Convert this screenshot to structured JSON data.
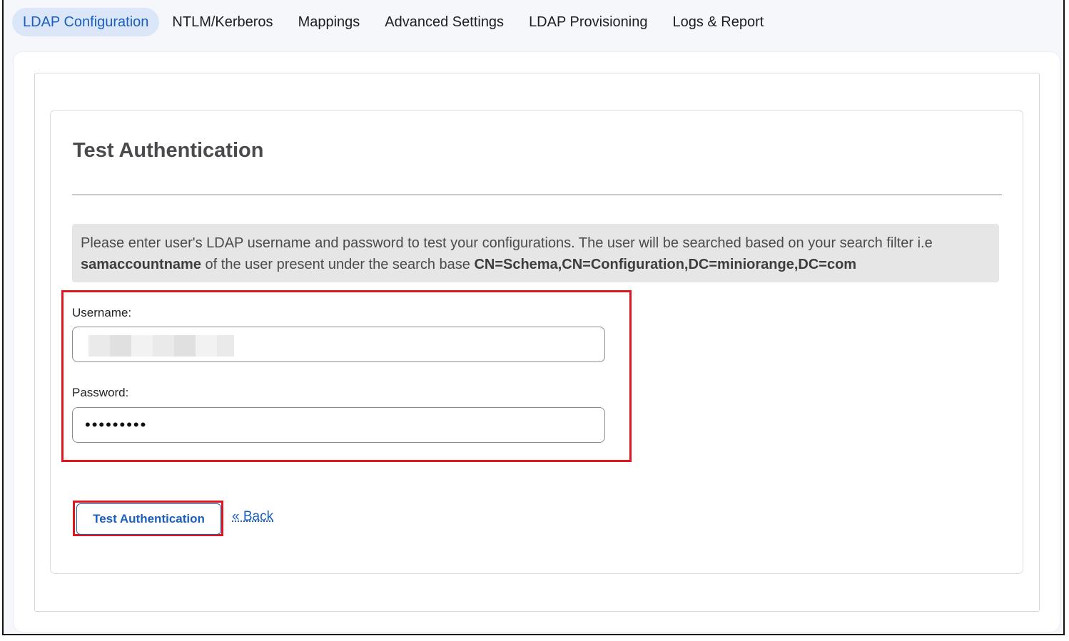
{
  "tabs": [
    {
      "label": "LDAP Configuration",
      "active": true
    },
    {
      "label": "NTLM/Kerberos",
      "active": false
    },
    {
      "label": "Mappings",
      "active": false
    },
    {
      "label": "Advanced Settings",
      "active": false
    },
    {
      "label": "LDAP Provisioning",
      "active": false
    },
    {
      "label": "Logs & Report",
      "active": false
    }
  ],
  "card": {
    "title": "Test Authentication",
    "info_text_1": "Please enter user's LDAP username and password to test your configurations. The user will be searched based on your search filter i.e ",
    "info_bold_1": "samaccountname",
    "info_text_2": " of the user present under the search base ",
    "info_bold_2": "CN=Schema,CN=Configuration,DC=miniorange,DC=com"
  },
  "form": {
    "username_label": "Username:",
    "username_value": "",
    "password_label": "Password:",
    "password_value": "•••••••••"
  },
  "actions": {
    "test_button_label": "Test Authentication",
    "back_link_label": "« Back"
  },
  "colors": {
    "accent": "#1a5fbf",
    "highlight": "#e0151d",
    "active_tab_bg": "#dbe7f9"
  }
}
